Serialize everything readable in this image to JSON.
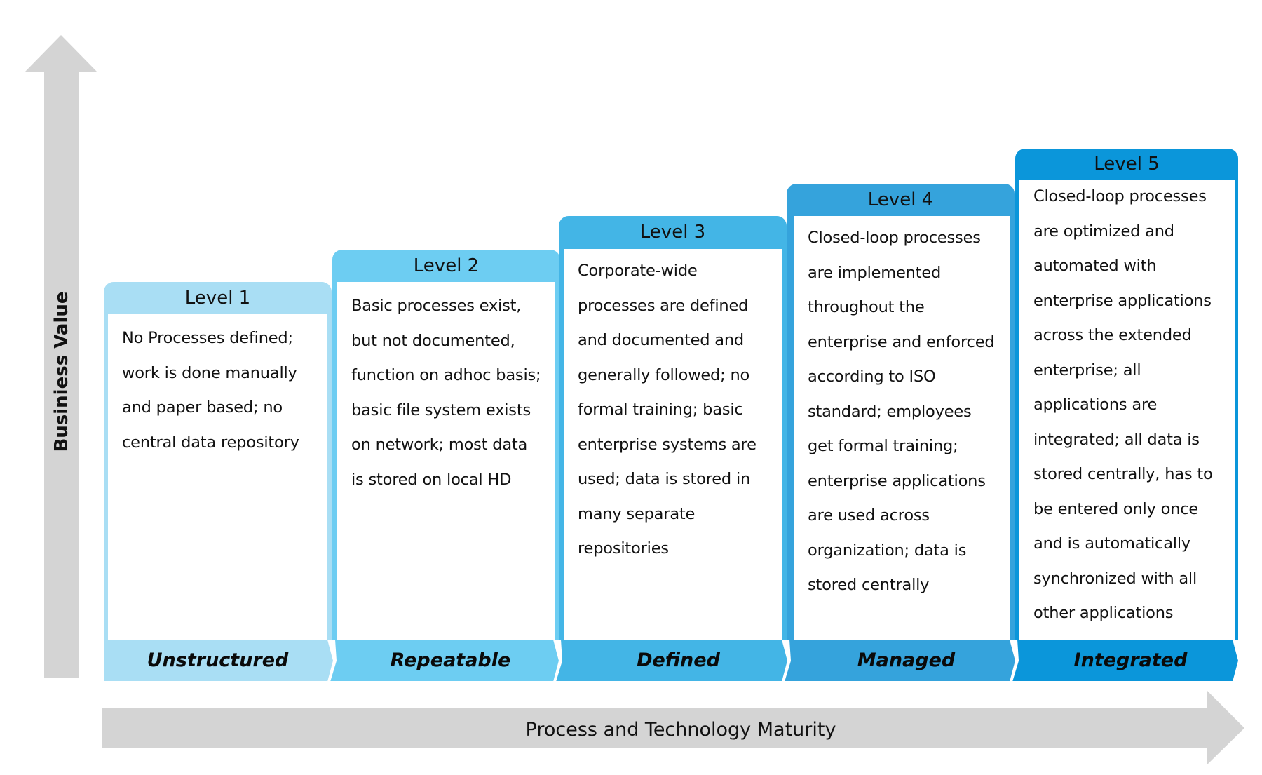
{
  "diagram": {
    "type": "maturity-model",
    "axes": {
      "y_label": "Businiess Value",
      "x_label": "Process and Technology Maturity"
    },
    "colors": {
      "arrow_gray": "#d4d4d4",
      "level_1": "#a9def4",
      "level_2": "#6dcdf2",
      "level_3": "#43b5e6",
      "level_4": "#35a3dc",
      "level_5": "#0b96da"
    },
    "levels": [
      {
        "title": "Level 1",
        "stage": "Unstructured",
        "lines": [
          "No Processes defined;",
          "work is done manually",
          "and paper based; no",
          "central data repository"
        ]
      },
      {
        "title": "Level 2",
        "stage": "Repeatable",
        "lines": [
          "Basic processes exist,",
          "but not documented,",
          "function on adhoc basis;",
          "basic file system exists",
          "on network; most data",
          "is stored on local HD"
        ]
      },
      {
        "title": "Level 3",
        "stage": "Defined",
        "lines": [
          "Corporate-wide",
          "processes are defined",
          "and documented and",
          "generally followed; no",
          "formal training; basic",
          "enterprise systems are",
          "used; data is stored in",
          "many separate",
          "repositories"
        ]
      },
      {
        "title": "Level 4",
        "stage": "Managed",
        "lines": [
          "Closed-loop processes",
          "are implemented",
          "throughout the",
          "enterprise and enforced",
          "according to ISO",
          "standard; employees",
          "get formal training;",
          "enterprise applications",
          "are used across",
          "organization; data is",
          "stored centrally"
        ]
      },
      {
        "title": "Level 5",
        "stage": "Integrated",
        "lines": [
          "Closed-loop processes",
          "are optimized and",
          "automated with",
          "enterprise applications",
          "across the extended",
          "enterprise; all",
          "applications are",
          "integrated; all data is",
          "stored centrally, has to",
          "be entered only once",
          "and is automatically",
          "synchronized with all",
          "other applications"
        ]
      }
    ]
  }
}
